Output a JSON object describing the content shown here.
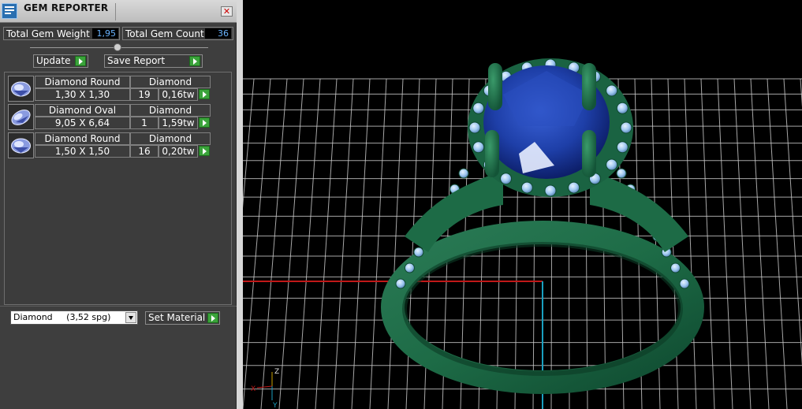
{
  "window": {
    "title": "GEM REPORTER",
    "close_symbol": "✕"
  },
  "stats": {
    "total_weight_label": "Total Gem Weight",
    "total_weight_value": "1,95",
    "total_count_label": "Total Gem Count",
    "total_count_value": "36"
  },
  "toolbar": {
    "update_label": "Update",
    "save_report_label": "Save Report"
  },
  "gems": [
    {
      "shape": "Diamond Round",
      "material": "Diamond",
      "size": "1,30 X 1,30",
      "count": "19",
      "weight": "0,16tw"
    },
    {
      "shape": "Diamond Oval",
      "material": "Diamond",
      "size": "9,05 X 6,64",
      "count": "1",
      "weight": "1,59tw"
    },
    {
      "shape": "Diamond Round",
      "material": "Diamond",
      "size": "1,50 X 1,50",
      "count": "16",
      "weight": "0,20tw"
    }
  ],
  "material_picker": {
    "selected": "Diamond     (3,52 spg)",
    "set_label": "Set Material"
  },
  "viewport": {
    "axis_z": "Z",
    "axis_x": "X",
    "axis_y": "Y",
    "colors": {
      "metal": "#1f6b46",
      "stone_center": "#1e3fa8",
      "side_stones": "#9ec7f0",
      "grid": "#d0d0d0",
      "x_axis": "#c01818",
      "y_axis": "#1aa0c0"
    }
  }
}
